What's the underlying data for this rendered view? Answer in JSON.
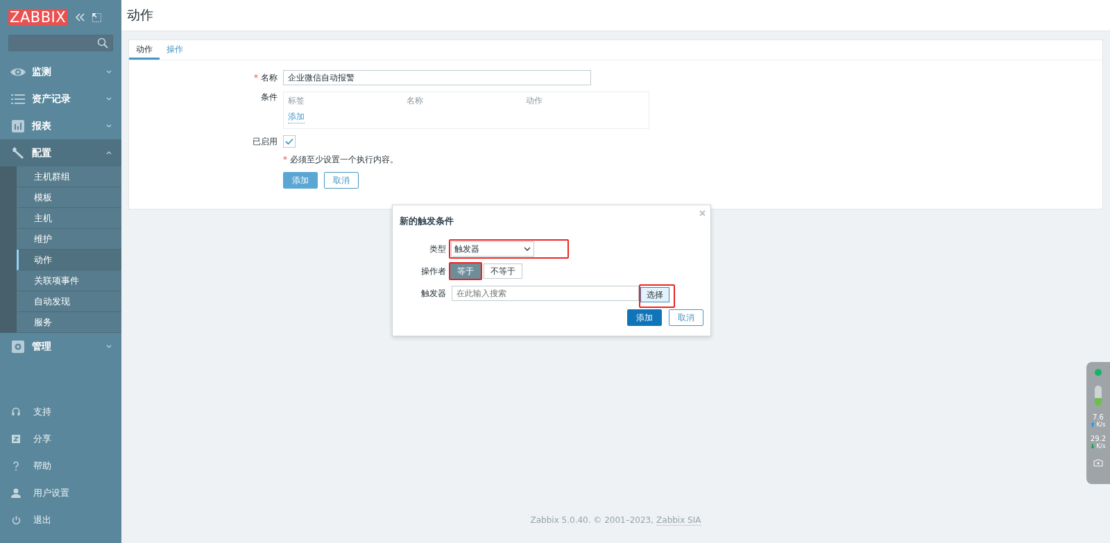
{
  "sidebar": {
    "logo": "ZABBIX",
    "menu": [
      {
        "label": "监测",
        "expanded": false
      },
      {
        "label": "资产记录",
        "expanded": false
      },
      {
        "label": "报表",
        "expanded": false
      },
      {
        "label": "配置",
        "expanded": true,
        "children": [
          {
            "label": "主机群组",
            "selected": false
          },
          {
            "label": "模板",
            "selected": false
          },
          {
            "label": "主机",
            "selected": false
          },
          {
            "label": "维护",
            "selected": false
          },
          {
            "label": "动作",
            "selected": true
          },
          {
            "label": "关联项事件",
            "selected": false
          },
          {
            "label": "自动发现",
            "selected": false
          },
          {
            "label": "服务",
            "selected": false
          }
        ]
      },
      {
        "label": "管理",
        "expanded": false
      }
    ],
    "bottom_menu": [
      "支持",
      "分享",
      "帮助",
      "用户设置",
      "退出"
    ]
  },
  "page_title": "动作",
  "tabs": [
    {
      "label": "动作",
      "selected": true
    },
    {
      "label": "操作",
      "selected": false
    }
  ],
  "form": {
    "name": {
      "label": "名称",
      "required_mark": "*",
      "value": "企业微信自动报警"
    },
    "conditions": {
      "label": "条件",
      "columns": [
        "标签",
        "名称",
        "动作"
      ],
      "add_link": "添加"
    },
    "enabled": {
      "label": "已启用",
      "checked": true
    },
    "note": {
      "text": "必须至少设置一个执行内容。",
      "required_mark": "*"
    },
    "buttons": [
      {
        "label": "添加",
        "kind": "primary"
      },
      {
        "label": "取消",
        "kind": "secondary"
      }
    ]
  },
  "dialog": {
    "title": "新的触发条件",
    "type": {
      "label": "类型",
      "value": "触发器",
      "highlighted": true
    },
    "operator": {
      "label": "操作者",
      "options": [
        {
          "label": "等于",
          "selected": true,
          "highlighted": true
        },
        {
          "label": "不等于",
          "selected": false,
          "highlighted": false
        }
      ]
    },
    "trigger": {
      "label": "触发器",
      "placeholder": "在此输入搜索",
      "button": {
        "label": "选择",
        "highlighted": true
      }
    },
    "buttons": [
      {
        "label": "添加",
        "kind": "primary"
      },
      {
        "label": "取消",
        "kind": "secondary"
      }
    ]
  },
  "footer": {
    "text": "Zabbix 5.0.40. © 2001–2023,",
    "link": "Zabbix SIA"
  },
  "net_widget": {
    "upload": "7.6",
    "upload_unit": "K/s",
    "download": "29.2",
    "download_unit": "K/s"
  }
}
